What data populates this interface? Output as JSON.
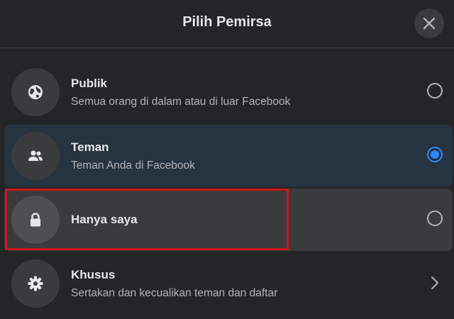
{
  "dialog": {
    "title": "Pilih Pemirsa",
    "close_icon": "close-icon"
  },
  "options": [
    {
      "id": "publik",
      "icon": "globe-icon",
      "label": "Publik",
      "description": "Semua orang di dalam atau di luar Facebook",
      "control": "radio",
      "selected": false
    },
    {
      "id": "teman",
      "icon": "friends-icon",
      "label": "Teman",
      "description": "Teman Anda di Facebook",
      "control": "radio",
      "selected": true
    },
    {
      "id": "hanya-saya",
      "icon": "lock-icon",
      "label": "Hanya saya",
      "description": "",
      "control": "radio",
      "selected": false,
      "highlighted": true
    },
    {
      "id": "khusus",
      "icon": "gear-icon",
      "label": "Khusus",
      "description": "Sertakan dan kecualikan teman dan daftar",
      "control": "chevron-right-icon",
      "selected": false
    }
  ],
  "colors": {
    "background": "#242526",
    "selected_row": "#263340",
    "hover_row": "#3a3b3c",
    "accent": "#2d88ff",
    "annotation": "#d0141c"
  }
}
